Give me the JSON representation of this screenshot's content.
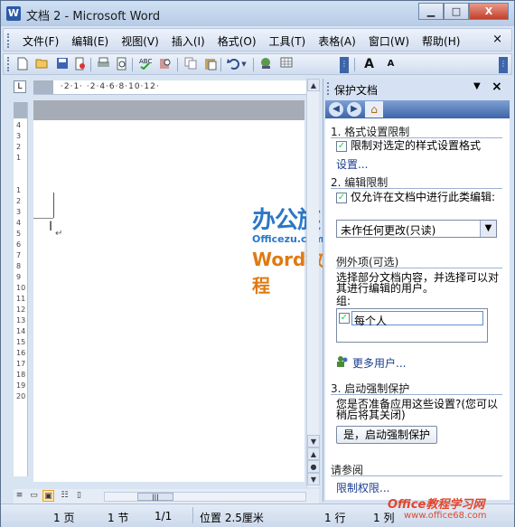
{
  "window": {
    "title": "文档 2 - Microsoft Word",
    "app_icon": "W",
    "controls": {
      "minimize": "▁",
      "maximize": "□",
      "close": "X"
    }
  },
  "menu": {
    "items": [
      "文件(F)",
      "编辑(E)",
      "视图(V)",
      "插入(I)",
      "格式(O)",
      "工具(T)",
      "表格(A)",
      "窗口(W)",
      "帮助(H)"
    ],
    "close_glyph": "×"
  },
  "toolbar": {
    "icons": [
      "new-document-icon",
      "open-icon",
      "save-icon",
      "permission-icon",
      "print-icon",
      "print-preview-icon",
      "spelling-icon",
      "research-icon",
      "copy-icon",
      "paste-icon",
      "undo-icon",
      "hyperlink-icon",
      "table-icon"
    ],
    "font_grow": "A",
    "font_shrink": "A"
  },
  "ruler": {
    "corner": "L",
    "horizontal_ticks": "·2·1· ·2·4·6·8·10·12·",
    "vertical_numbers": [
      "4",
      "3",
      "2",
      "1",
      "1",
      "2",
      "3",
      "4",
      "5",
      "6",
      "7",
      "8",
      "9",
      "10",
      "11",
      "12",
      "13",
      "14",
      "15",
      "16",
      "17",
      "18",
      "19",
      "20"
    ]
  },
  "document": {
    "paragraph_mark": "↵"
  },
  "watermark": {
    "line1": "办公族",
    "line2": "Officezu.com",
    "line3": "Word教程",
    "footer_brand": "Office教程学习网",
    "footer_url": "www.office68.com"
  },
  "taskpane": {
    "title": "保护文档",
    "section1": {
      "title": "1. 格式设置限制",
      "checkbox_label": "限制对选定的样式设置格式",
      "checked": true,
      "link": "设置..."
    },
    "section2": {
      "title": "2. 编辑限制",
      "checkbox_label": "仅允许在文档中进行此类编辑:",
      "checked": true,
      "dropdown_value": "未作任何更改(只读)"
    },
    "exceptions": {
      "title": "例外项(可选)",
      "description": "选择部分文档内容，并选择可以对其进行编辑的用户。",
      "group_label": "组:",
      "group_item": "每个人",
      "group_item_checked": true,
      "more_users": "更多用户..."
    },
    "section3": {
      "title": "3. 启动强制保护",
      "question": "您是否准备应用这些设置?(您可以稍后将其关闭)",
      "button": "是，启动强制保护"
    },
    "see_also": {
      "title": "请参阅",
      "link": "限制权限..."
    }
  },
  "status": {
    "page": "1 页",
    "section": "1 节",
    "page_of": "1/1",
    "position": "位置 2.5厘米",
    "line": "1 行",
    "column": "1 列"
  }
}
